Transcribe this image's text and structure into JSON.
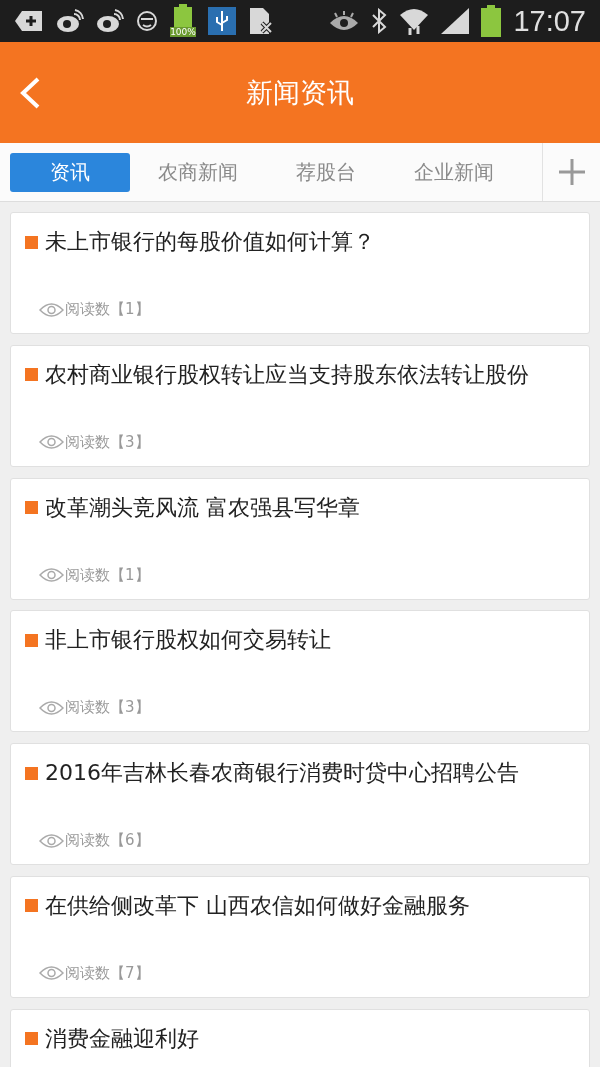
{
  "status_bar": {
    "battery_label": "100%",
    "time": "17:07"
  },
  "header": {
    "title": "新闻资讯"
  },
  "tabs": [
    {
      "label": "资讯",
      "selected": true
    },
    {
      "label": "农商新闻",
      "selected": false
    },
    {
      "label": "荐股台",
      "selected": false
    },
    {
      "label": "企业新闻",
      "selected": false
    }
  ],
  "news": [
    {
      "title": "未上市银行的每股价值如何计算？",
      "reads": "阅读数【1】"
    },
    {
      "title": "农村商业银行股权转让应当支持股东依法转让股份",
      "reads": "阅读数【3】"
    },
    {
      "title": "改革潮头竞风流 富农强县写华章",
      "reads": "阅读数【1】"
    },
    {
      "title": "非上市银行股权如何交易转让",
      "reads": "阅读数【3】"
    },
    {
      "title": "2016年吉林长春农商银行消费时贷中心招聘公告",
      "reads": "阅读数【6】"
    },
    {
      "title": "在供给侧改革下 山西农信如何做好金融服务",
      "reads": "阅读数【7】"
    },
    {
      "title": "消费金融迎利好"
    }
  ]
}
